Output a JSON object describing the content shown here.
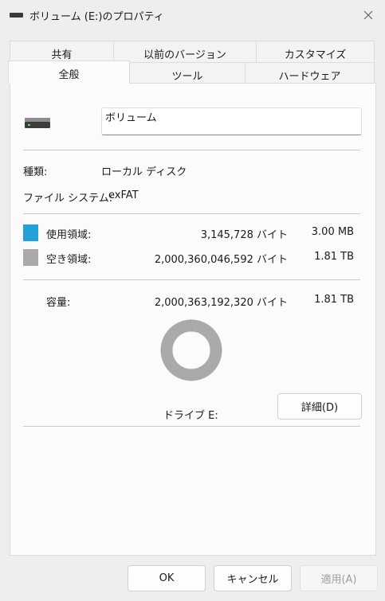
{
  "window": {
    "title": "ボリューム (E:)のプロパティ"
  },
  "tabs": {
    "row1": [
      {
        "label": "共有"
      },
      {
        "label": "以前のバージョン"
      },
      {
        "label": "カスタマイズ"
      }
    ],
    "row2": [
      {
        "label": "全般",
        "active": true
      },
      {
        "label": "ツール"
      },
      {
        "label": "ハードウェア"
      }
    ]
  },
  "general": {
    "volume_name": "ボリューム",
    "type_label": "種類:",
    "type_value": "ローカル ディスク",
    "fs_label": "ファイル システム:",
    "fs_value": "exFAT",
    "used": {
      "label": "使用領域:",
      "bytes": "3,145,728 バイト",
      "size": "3.00 MB",
      "color": "#26a0da"
    },
    "free": {
      "label": "空き領域:",
      "bytes": "2,000,360,046,592 バイト",
      "size": "1.81 TB",
      "color": "#aaaaaa"
    },
    "capacity": {
      "label": "容量:",
      "bytes": "2,000,363,192,320 バイト",
      "size": "1.81 TB"
    },
    "drive_label": "ドライブ E:",
    "details_button": "詳細(D)",
    "used_fraction": 1.6e-06
  },
  "footer": {
    "ok": "OK",
    "cancel": "キャンセル",
    "apply": "適用(A)"
  }
}
